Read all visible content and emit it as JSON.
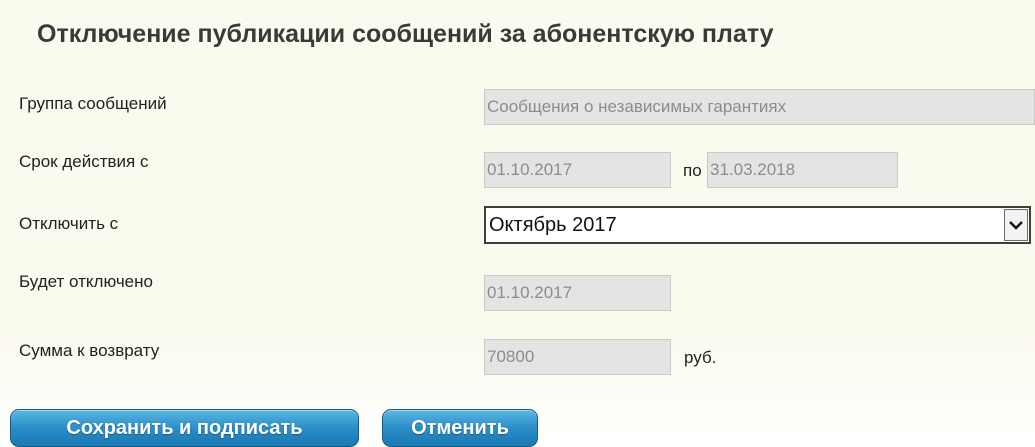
{
  "title": "Отключение публикации сообщений за абонентскую плату",
  "form": {
    "message_group": {
      "label": "Группа сообщений",
      "value": "Сообщения о независимых гарантиях"
    },
    "validity": {
      "label": "Срок действия с",
      "from": "01.10.2017",
      "to_label": "по",
      "to": "31.03.2018"
    },
    "disable_from": {
      "label": "Отключить с",
      "selected": "Октябрь 2017"
    },
    "will_be_disabled": {
      "label": "Будет отключено",
      "value": "01.10.2017"
    },
    "refund": {
      "label": "Сумма к возврату",
      "value": "70800",
      "unit": "руб."
    }
  },
  "buttons": {
    "save_sign": "Сохранить и подписать",
    "cancel": "Отменить"
  },
  "icons": {
    "select_arrow": "chevron-down-icon"
  },
  "colors": {
    "button": "#2b8ec6",
    "panel": "#fbfaee",
    "field": "#e4e4e4"
  }
}
